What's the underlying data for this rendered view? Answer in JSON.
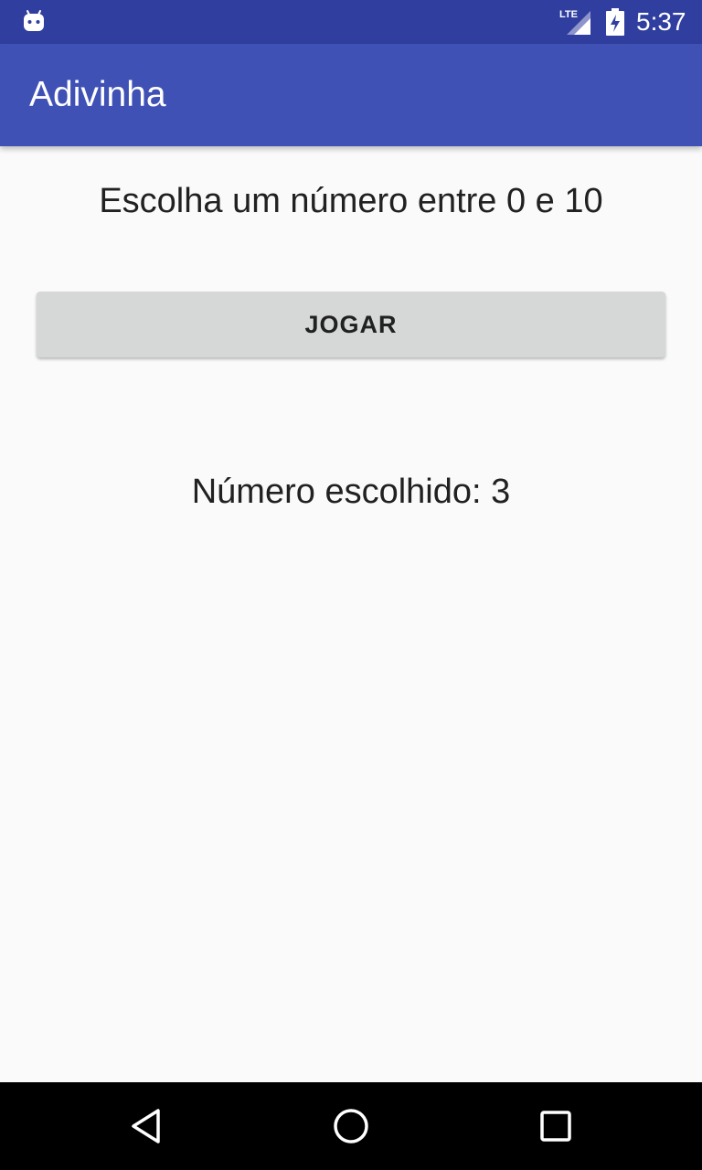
{
  "status_bar": {
    "time": "5:37",
    "network_label": "LTE",
    "icons": [
      "android-debug-icon",
      "lte-signal-icon",
      "battery-charging-icon"
    ]
  },
  "app_bar": {
    "title": "Adivinha",
    "color": "#3f51b5",
    "status_color": "#303f9f"
  },
  "main": {
    "prompt": "Escolha um número entre 0 e 10",
    "play_button_label": "JOGAR",
    "result_text": "Número escolhido: 3"
  },
  "nav_bar": {
    "icons": [
      "back-icon",
      "home-icon",
      "recents-icon"
    ]
  }
}
